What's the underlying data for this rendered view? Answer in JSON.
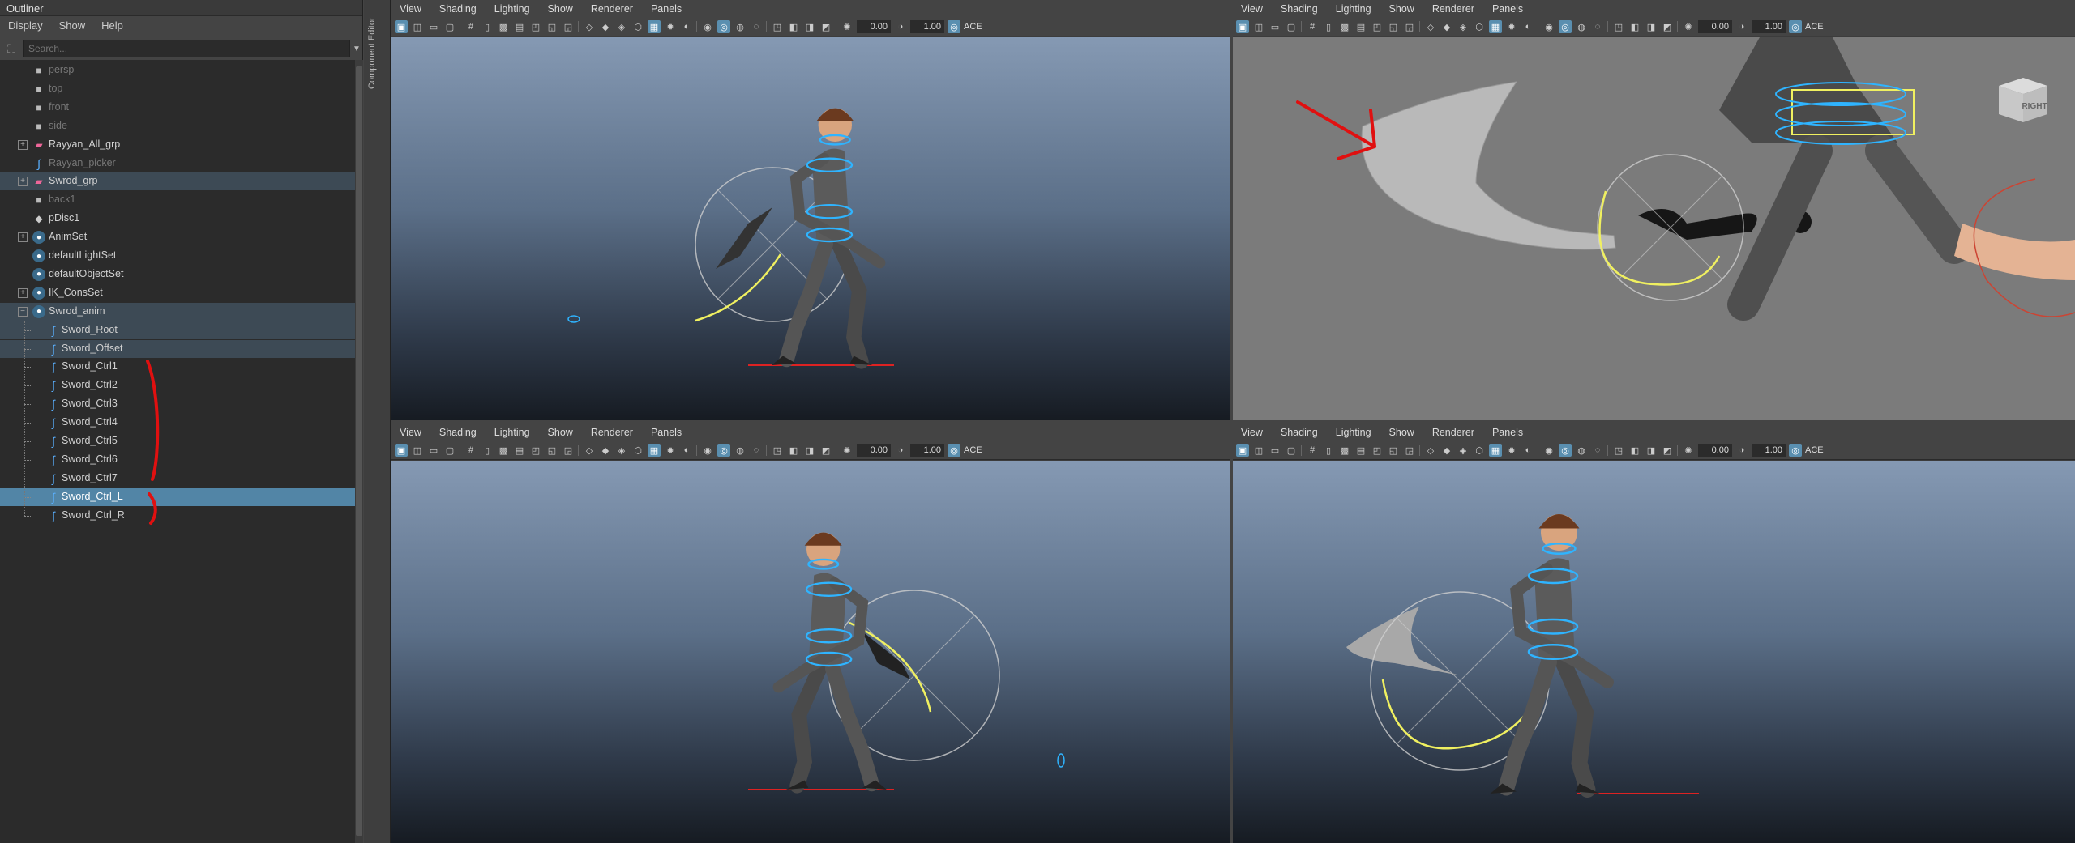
{
  "outliner": {
    "title": "Outliner",
    "menu": [
      "Display",
      "Show",
      "Help"
    ],
    "search_placeholder": "Search...",
    "items": [
      {
        "label": "persp",
        "icon": "camera-icon"
      },
      {
        "label": "top",
        "icon": "camera-icon"
      },
      {
        "label": "front",
        "icon": "camera-icon"
      },
      {
        "label": "side",
        "icon": "camera-icon"
      },
      {
        "label": "Rayyan_All_grp",
        "icon": "group-icon"
      },
      {
        "label": "Rayyan_picker",
        "icon": "curve-icon"
      },
      {
        "label": "Swrod_grp",
        "icon": "group-icon"
      },
      {
        "label": "back1",
        "icon": "camera-icon"
      },
      {
        "label": "pDisc1",
        "icon": "mesh-icon"
      },
      {
        "label": "AnimSet",
        "icon": "set-icon"
      },
      {
        "label": "defaultLightSet",
        "icon": "set-icon"
      },
      {
        "label": "defaultObjectSet",
        "icon": "set-icon"
      },
      {
        "label": "IK_ConsSet",
        "icon": "set-icon"
      },
      {
        "label": "Swrod_anim",
        "icon": "set-icon"
      },
      {
        "label": "Sword_Root",
        "icon": "curve-icon"
      },
      {
        "label": "Sword_Offset",
        "icon": "curve-icon"
      },
      {
        "label": "Sword_Ctrl1",
        "icon": "curve-icon"
      },
      {
        "label": "Sword_Ctrl2",
        "icon": "curve-icon"
      },
      {
        "label": "Sword_Ctrl3",
        "icon": "curve-icon"
      },
      {
        "label": "Sword_Ctrl4",
        "icon": "curve-icon"
      },
      {
        "label": "Sword_Ctrl5",
        "icon": "curve-icon"
      },
      {
        "label": "Sword_Ctrl6",
        "icon": "curve-icon"
      },
      {
        "label": "Sword_Ctrl7",
        "icon": "curve-icon"
      },
      {
        "label": "Sword_Ctrl_L",
        "icon": "curve-icon"
      },
      {
        "label": "Sword_Ctrl_R",
        "icon": "curve-icon"
      }
    ]
  },
  "component_editor": {
    "label": "Component Editor"
  },
  "viewport": {
    "menu": [
      "View",
      "Shading",
      "Lighting",
      "Show",
      "Renderer",
      "Panels"
    ],
    "exposure": "0.00",
    "gamma": "1.00",
    "color_space": "ACE"
  },
  "view_cube": {
    "label": "RIGHT"
  },
  "colors": {
    "accent": "#5a8fb0",
    "selection": "#5285a6",
    "annotation": "#e01010"
  }
}
